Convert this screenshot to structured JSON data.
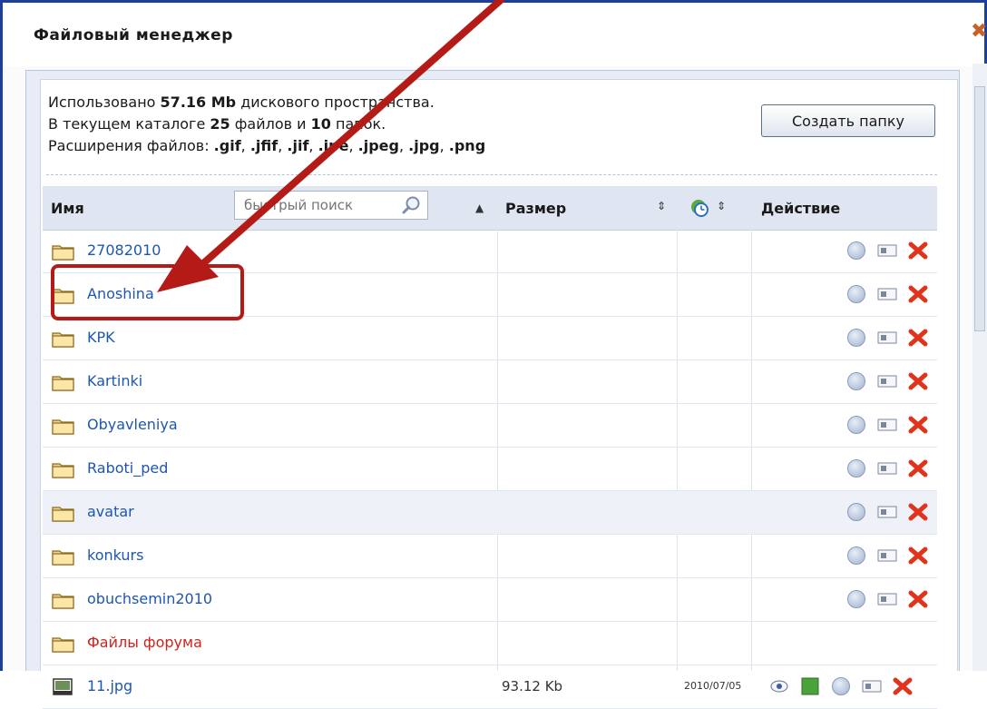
{
  "window": {
    "title": "Файловый менеджер"
  },
  "info": {
    "line1_pre": "Использовано ",
    "line1_value": "57.16 Mb",
    "line1_post": " дискового пространства.",
    "line2_pre": "В текущем каталоге ",
    "line2_files": "25",
    "line2_mid": " файлов и ",
    "line2_folders": "10",
    "line2_post": " папок.",
    "line3_pre": "Расширения файлов: ",
    "extensions": [
      ".gif",
      ".jfif",
      ".jif",
      ".jpe",
      ".jpeg",
      ".jpg",
      ".png"
    ]
  },
  "create_folder_label": "Создать папку",
  "table": {
    "col_name": "Имя",
    "search_placeholder": "быстрый поиск",
    "col_size": "Размер",
    "col_action": "Действие",
    "rows": [
      {
        "name": "27082010",
        "size": "",
        "date": ""
      },
      {
        "name": "Anoshina",
        "size": "",
        "date": ""
      },
      {
        "name": "KPK",
        "size": "",
        "date": ""
      },
      {
        "name": "Kartinki",
        "size": "",
        "date": ""
      },
      {
        "name": "Obyavleniya",
        "size": "",
        "date": ""
      },
      {
        "name": "Raboti_ped",
        "size": "",
        "date": ""
      },
      {
        "name": "avatar",
        "size": "",
        "date": ""
      },
      {
        "name": "konkurs",
        "size": "",
        "date": ""
      },
      {
        "name": "obuchsemin2010",
        "size": "",
        "date": ""
      },
      {
        "name": "Файлы форума",
        "size": "",
        "date": ""
      },
      {
        "name": "11.jpg",
        "size": "93.12 Kb",
        "date": "2010/07/05"
      }
    ]
  },
  "colors": {
    "accent": "#1e56b0",
    "annotation": "#b51b16",
    "delete": "#e0341f"
  }
}
